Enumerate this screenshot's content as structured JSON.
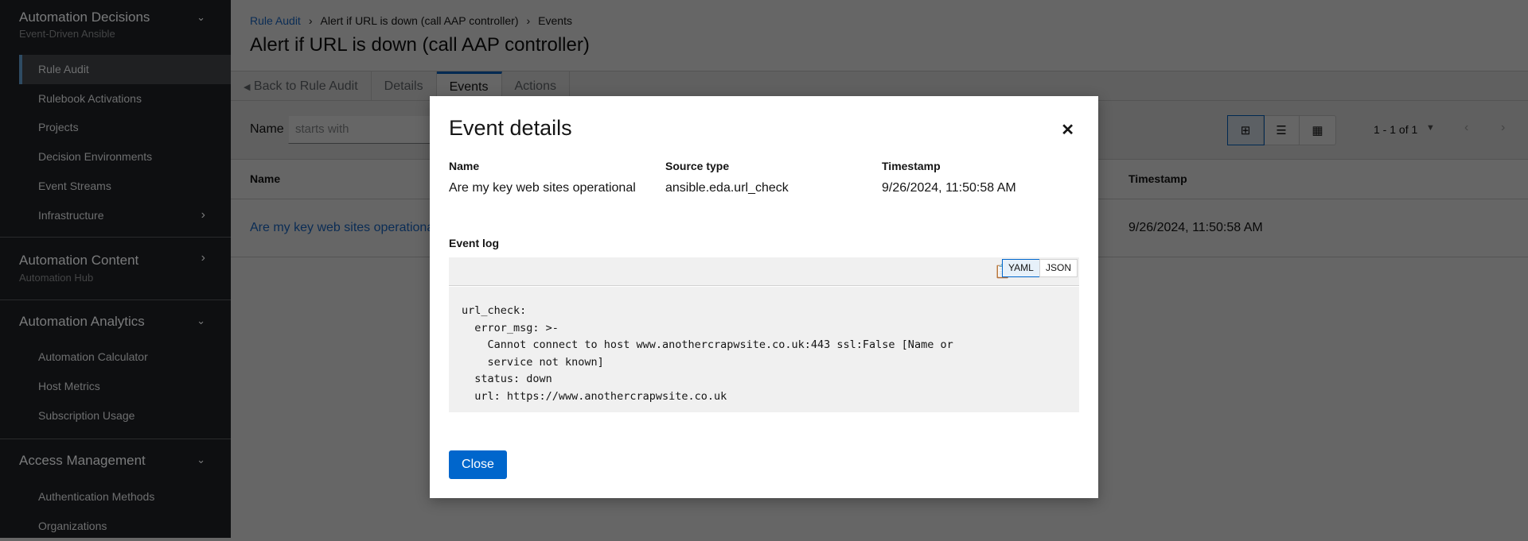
{
  "sidebar": {
    "groups": [
      {
        "title": "Automation Decisions",
        "subtitle": "Event-Driven Ansible",
        "items": [
          "Rule Audit",
          "Rulebook Activations",
          "Projects",
          "Decision Environments",
          "Event Streams",
          "Infrastructure"
        ]
      },
      {
        "title": "Automation Content",
        "subtitle": "Automation Hub"
      },
      {
        "title": "Automation Analytics",
        "items": [
          "Automation Calculator",
          "Host Metrics",
          "Subscription Usage"
        ]
      },
      {
        "title": "Access Management",
        "items": [
          "Authentication Methods",
          "Organizations"
        ]
      }
    ],
    "active": "Rule Audit"
  },
  "breadcrumb": [
    "Rule Audit",
    "Alert if URL is down (call AAP controller)",
    "Events"
  ],
  "page_title": "Alert if URL is down (call AAP controller)",
  "tabs": [
    "Back to Rule Audit",
    "Details",
    "Events",
    "Actions"
  ],
  "selected_tab": "Events",
  "toolbar": {
    "filter_label": "Name",
    "filter_placeholder": "starts with",
    "pagination": "1 - 1 of 1"
  },
  "table": {
    "columns": [
      "Name",
      "Timestamp"
    ],
    "rows": [
      {
        "name": "Are my key web sites operational",
        "timestamp": "9/26/2024, 11:50:58 AM"
      }
    ]
  },
  "modal": {
    "title": "Event details",
    "fields": [
      {
        "label": "Name",
        "value": "Are my key web sites operational"
      },
      {
        "label": "Source type",
        "value": "ansible.eda.url_check"
      },
      {
        "label": "Timestamp",
        "value": "9/26/2024, 11:50:58 AM"
      }
    ],
    "event_log_label": "Event log",
    "format_options": [
      "YAML",
      "JSON"
    ],
    "selected_format": "YAML",
    "code": "url_check:\n  error_msg: >-\n    Cannot connect to host www.anothercrapwsite.co.uk:443 ssl:False [Name or\n    service not known]\n  status: down\n  url: https://www.anothercrapwsite.co.uk",
    "close_label": "Close"
  }
}
